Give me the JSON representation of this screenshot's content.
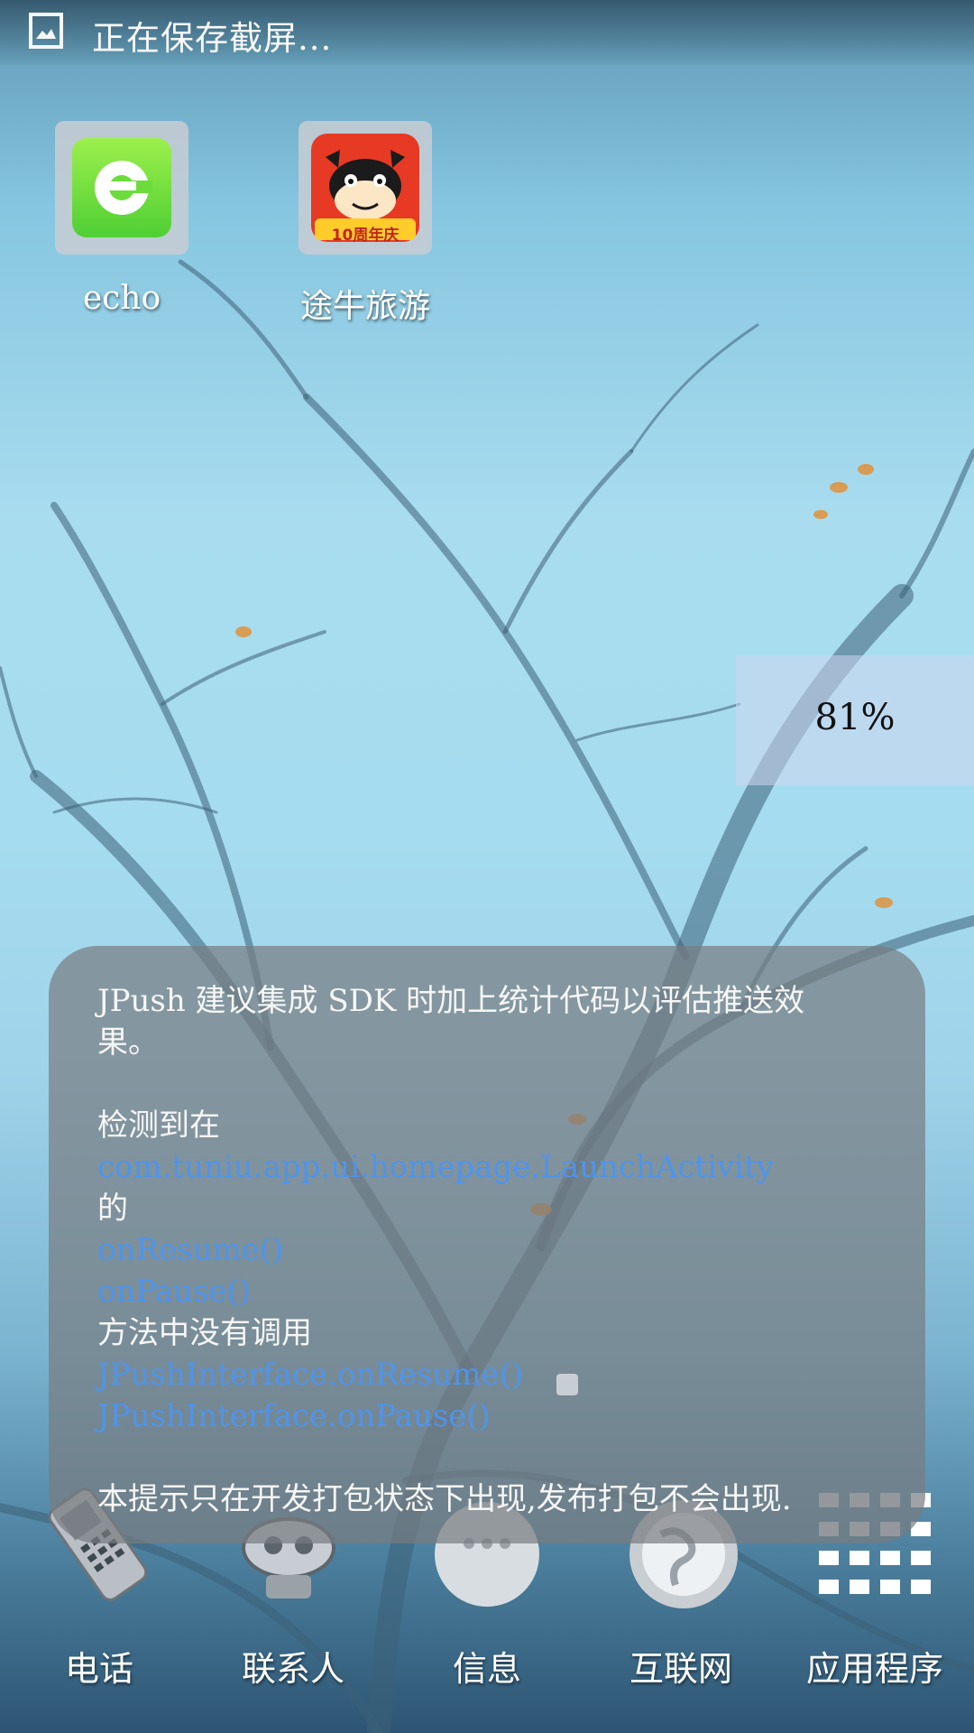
{
  "status": {
    "text": "正在保存截屏..."
  },
  "desktop": {
    "apps": [
      {
        "label": "echo"
      },
      {
        "label": "途牛旅游",
        "badge_text": "10周年庆"
      }
    ]
  },
  "battery_widget": {
    "value": "81%"
  },
  "toast": {
    "line1": "JPush 建议集成 SDK 时加上统计代码以评估推送效",
    "line2": "果。",
    "line3": "检测到在",
    "activity": "com.tuniu.app.ui.homepage.LaunchActivity",
    "line5": "的",
    "method1": "onResume()",
    "method2": "onPause()",
    "line8": "方法中没有调用",
    "call1": "JPushInterface.onResume()",
    "call2": "JPushInterface.onPause()",
    "footer": "本提示只在开发打包状态下出现,发布打包不会出现."
  },
  "dock": [
    {
      "label": "电话",
      "icon": "phone-icon"
    },
    {
      "label": "联系人",
      "icon": "contacts-icon"
    },
    {
      "label": "信息",
      "icon": "messages-icon"
    },
    {
      "label": "互联网",
      "icon": "internet-icon"
    },
    {
      "label": "应用程序",
      "icon": "apps-grid-icon"
    }
  ],
  "colors": {
    "link_blue": "#4e94ec",
    "toast_bg": "#787c80"
  }
}
